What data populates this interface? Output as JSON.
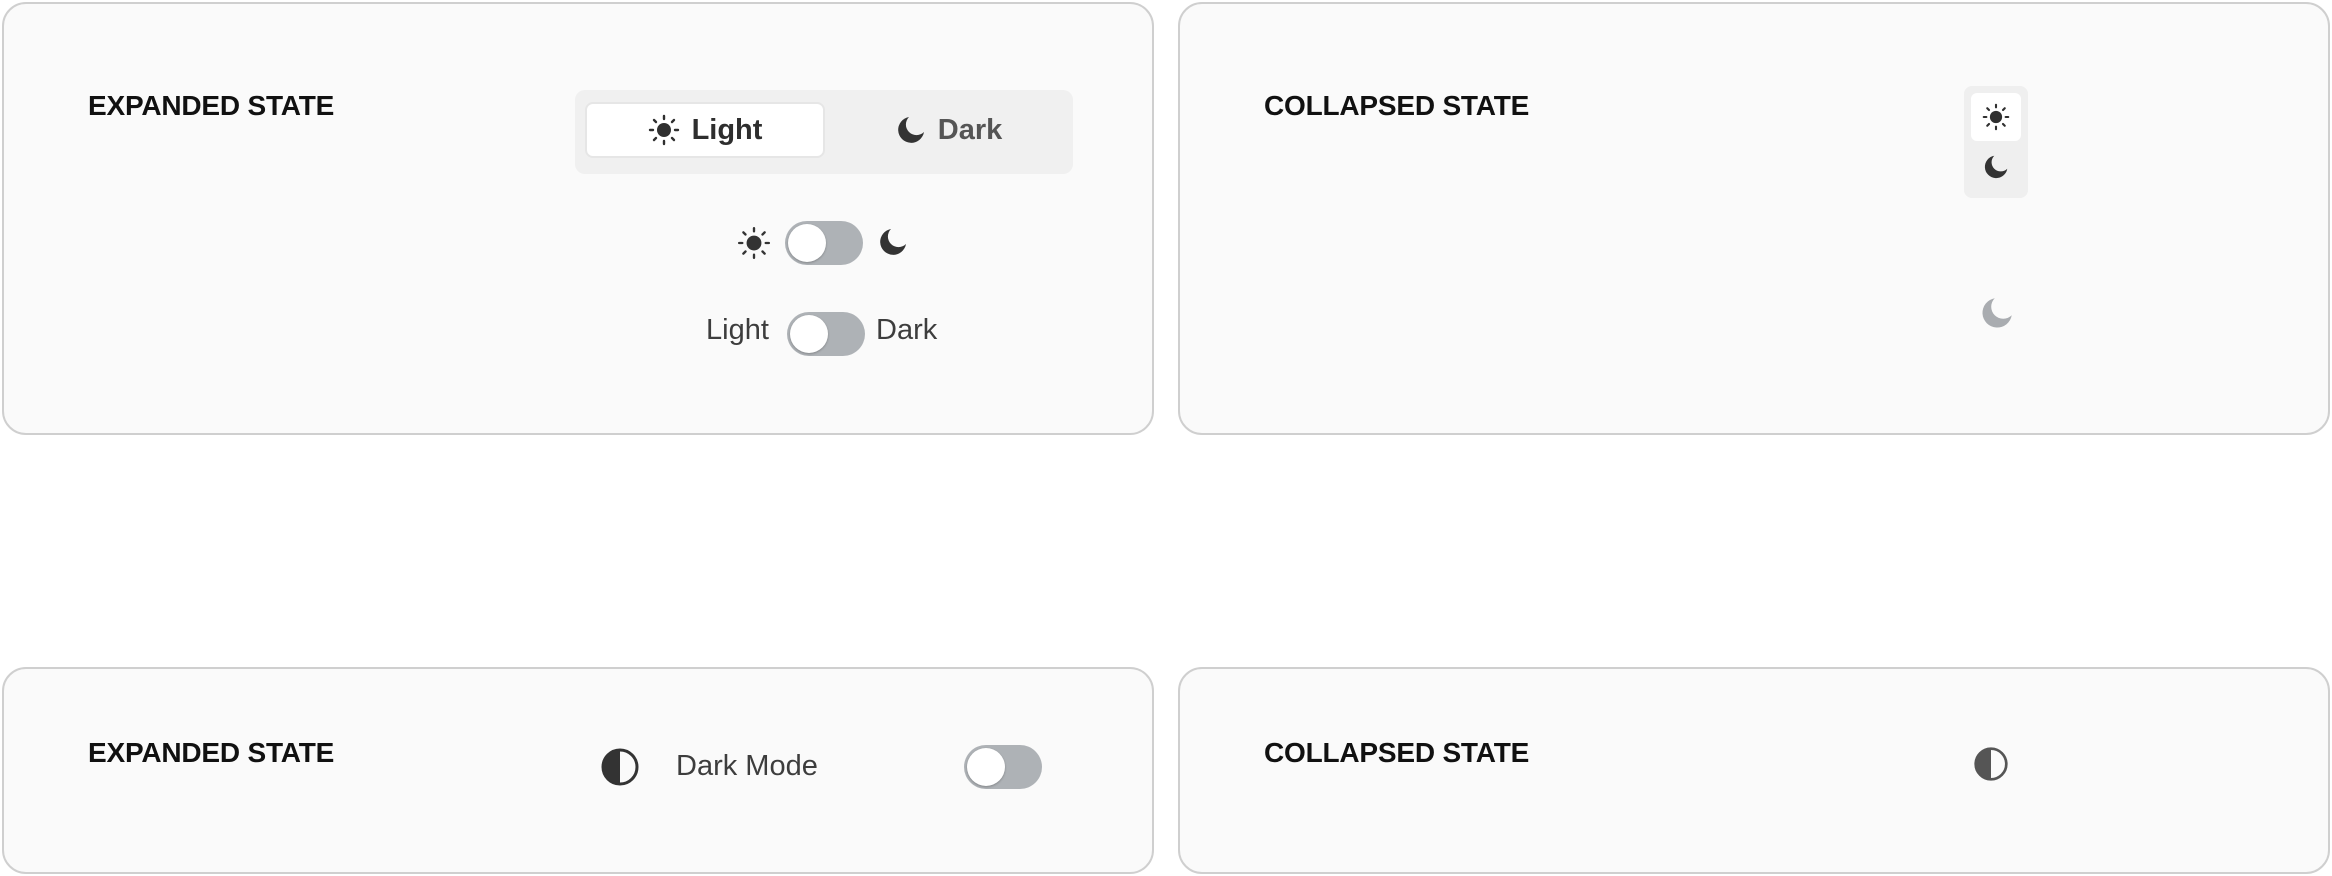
{
  "theme_switcher": {
    "panel_expanded_top": {
      "heading": "EXPANDED STATE",
      "segmented": {
        "light_label": "Light",
        "dark_label": "Dark",
        "selected": "Light"
      },
      "icon_toggle": {
        "left_icon": "sun-icon",
        "right_icon": "moon-icon",
        "state": "off"
      },
      "text_toggle": {
        "left_label": "Light",
        "right_label": "Dark",
        "state": "off"
      }
    },
    "panel_collapsed_top": {
      "heading": "COLLAPSED STATE",
      "vertical_segmented": {
        "top_icon": "sun-icon",
        "bottom_icon": "moon-icon",
        "selected": "sun-icon"
      },
      "single_icon_button": "moon-icon"
    },
    "panel_expanded_bottom": {
      "heading": "EXPANDED STATE",
      "row_icon": "contrast-icon",
      "row_label": "Dark Mode",
      "toggle_state": "off"
    },
    "panel_collapsed_bottom": {
      "heading": "COLLAPSED STATE",
      "icon": "contrast-icon"
    }
  },
  "colors": {
    "card_background": "#fafafa",
    "card_border": "#cfcfcf",
    "switch_track": "#aeb2b6",
    "icon_dark": "#333333",
    "icon_muted": "#a9acb0"
  }
}
